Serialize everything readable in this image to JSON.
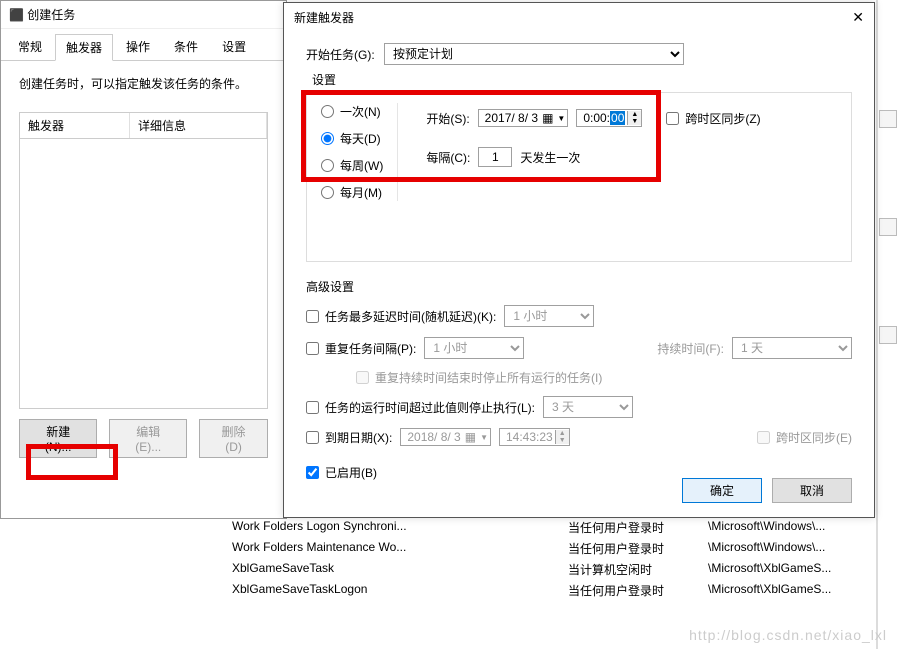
{
  "dlg1": {
    "title": "创建任务",
    "tabs": [
      "常规",
      "触发器",
      "操作",
      "条件",
      "设置"
    ],
    "active_tab": 1,
    "hint": "创建任务时，可以指定触发该任务的条件。",
    "columns": [
      "触发器",
      "详细信息"
    ],
    "buttons": {
      "new": "新建(N)...",
      "edit": "编辑(E)...",
      "delete": "删除(D)"
    }
  },
  "dlg2": {
    "title": "新建触发器",
    "begin_label": "开始任务(G):",
    "begin_value": "按预定计划",
    "settings_label": "设置",
    "frequency": {
      "once": "一次(N)",
      "daily": "每天(D)",
      "weekly": "每周(W)",
      "monthly": "每月(M)",
      "selected": "daily"
    },
    "start_label": "开始(S):",
    "start_date": "2017/ 8/ 3",
    "start_time_prefix": "0:00:",
    "start_time_sel": "00",
    "sync_tz": "跨时区同步(Z)",
    "recur_label": "每隔(C):",
    "recur_value": "1",
    "recur_suffix": "天发生一次",
    "adv_label": "高级设置",
    "adv": {
      "delay": "任务最多延迟时间(随机延迟)(K):",
      "delay_val": "1 小时",
      "repeat": "重复任务间隔(P):",
      "repeat_val": "1 小时",
      "duration_label": "持续时间(F):",
      "duration_val": "1 天",
      "stop_at_end": "重复持续时间结束时停止所有运行的任务(I)",
      "stop_after": "任务的运行时间超过此值则停止执行(L):",
      "stop_after_val": "3 天",
      "expire": "到期日期(X):",
      "expire_date": "2018/ 8/ 3",
      "expire_time": "14:43:23",
      "expire_tz": "跨时区同步(E)",
      "enabled": "已启用(B)"
    },
    "ok": "确定",
    "cancel": "取消"
  },
  "bg_tasks": [
    {
      "name": "Work Folders Logon Synchroni...",
      "trigger": "当任何用户登录时",
      "path": "\\Microsoft\\Windows\\..."
    },
    {
      "name": "Work Folders Maintenance Wo...",
      "trigger": "当任何用户登录时",
      "path": "\\Microsoft\\Windows\\..."
    },
    {
      "name": "XblGameSaveTask",
      "trigger": "当计算机空闲时",
      "path": "\\Microsoft\\XblGameS..."
    },
    {
      "name": "XblGameSaveTaskLogon",
      "trigger": "当任何用户登录时",
      "path": "\\Microsoft\\XblGameS..."
    }
  ],
  "watermark": "http://blog.csdn.net/xiao_lxl"
}
